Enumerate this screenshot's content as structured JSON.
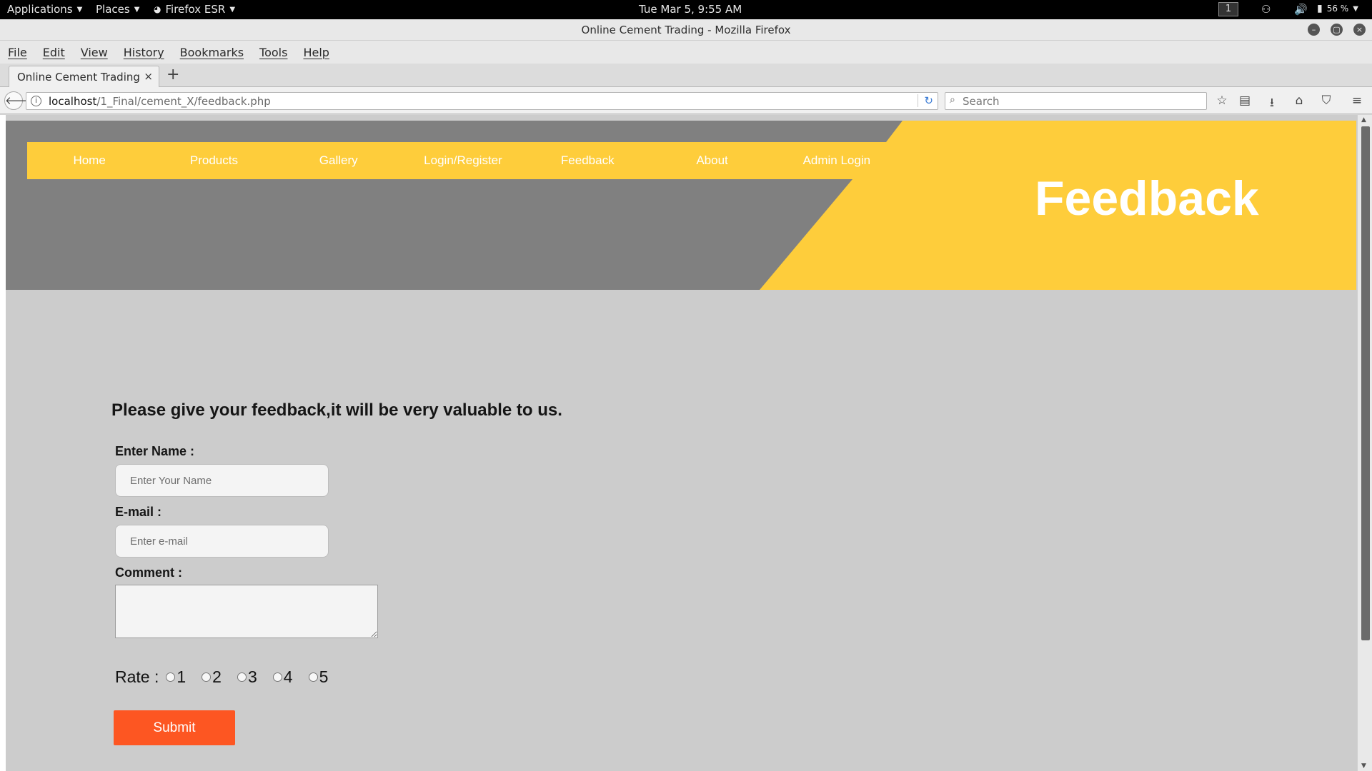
{
  "system_bar": {
    "applications": "Applications",
    "places": "Places",
    "firefox": "Firefox ESR",
    "clock": "Tue Mar  5,  9:55 AM",
    "workspace": "1",
    "battery": "56 %"
  },
  "window": {
    "title": "Online Cement Trading - Mozilla Firefox"
  },
  "menu": {
    "items": [
      "File",
      "Edit",
      "View",
      "History",
      "Bookmarks",
      "Tools",
      "Help"
    ]
  },
  "tabs": {
    "active_label": "Online Cement Trading",
    "close": "×",
    "new_tab": "+"
  },
  "navbar": {
    "url_host": "localhost",
    "url_path": "/1_Final/cement_X/feedback.php",
    "search_placeholder": "Search"
  },
  "site": {
    "nav": [
      "Home",
      "Products",
      "Gallery",
      "Login/Register",
      "Feedback",
      "About",
      "Admin Login"
    ],
    "page_title": "Feedback",
    "colors": {
      "accent_yellow": "#fecd3b",
      "header_gray": "#808080",
      "submit_orange": "#fd5622"
    }
  },
  "form": {
    "lead": "Please give your feedback,it will be very valuable to us.",
    "name_label": "Enter Name :",
    "name_placeholder": "Enter Your Name",
    "email_label": "E-mail :",
    "email_placeholder": "Enter e-mail",
    "comment_label": "Comment :",
    "rate_label": "Rate :",
    "rate_options": [
      "1",
      "2",
      "3",
      "4",
      "5"
    ],
    "submit_label": "Submit"
  }
}
